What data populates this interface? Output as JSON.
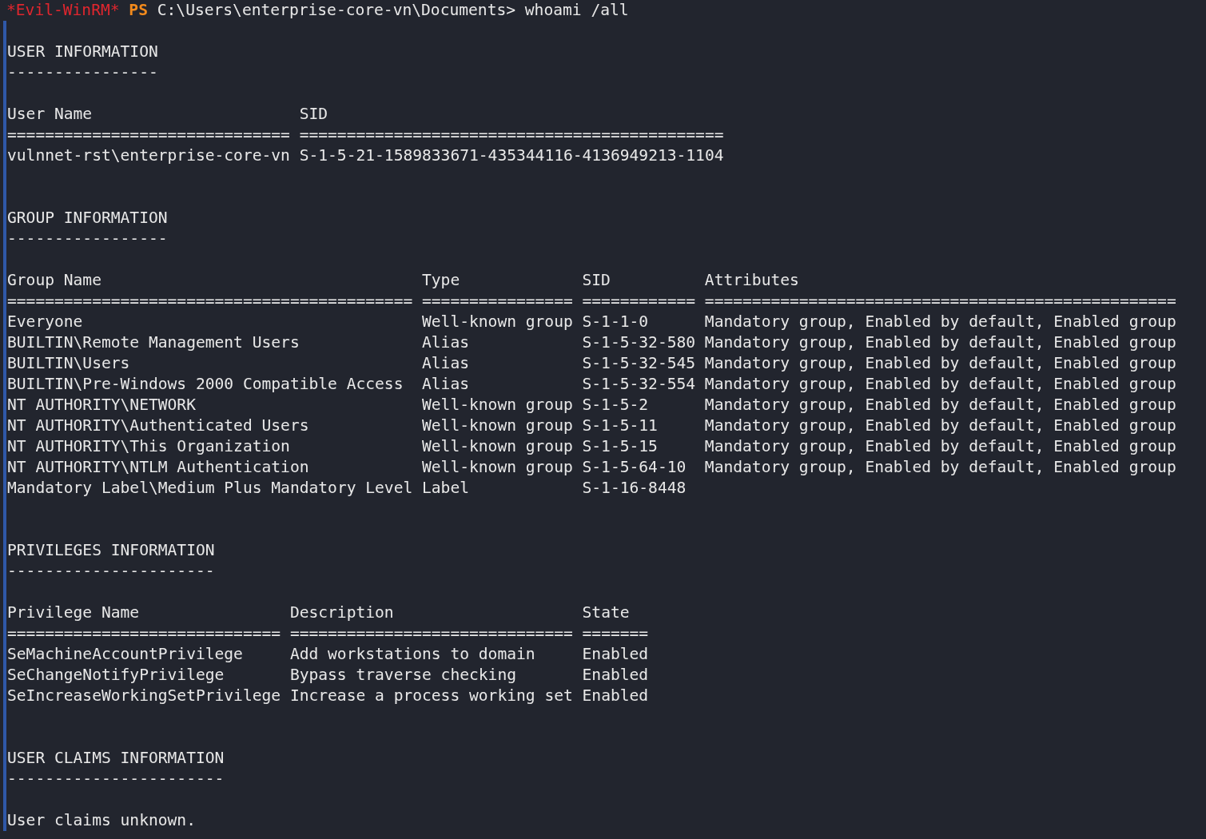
{
  "prompt": {
    "session": "*Evil-WinRM*",
    "shell": "PS",
    "path": "C:\\Users\\enterprise-core-vn\\Documents>",
    "command": "whoami /all"
  },
  "sections": [
    {
      "title": "USER INFORMATION",
      "underline": "----------------",
      "table": {
        "columns": [
          {
            "header": "User Name",
            "rule": "=============================="
          },
          {
            "header": "SID",
            "rule": "============================================="
          }
        ],
        "rows": [
          [
            "vulnnet-rst\\enterprise-core-vn",
            "S-1-5-21-1589833671-435344116-4136949213-1104"
          ]
        ]
      }
    },
    {
      "title": "GROUP INFORMATION",
      "underline": "-----------------",
      "table": {
        "columns": [
          {
            "header": "Group Name",
            "rule": "==========================================="
          },
          {
            "header": "Type",
            "rule": "================"
          },
          {
            "header": "SID",
            "rule": "============"
          },
          {
            "header": "Attributes",
            "rule": "=================================================="
          }
        ],
        "rows": [
          [
            "Everyone",
            "Well-known group",
            "S-1-1-0",
            "Mandatory group, Enabled by default, Enabled group"
          ],
          [
            "BUILTIN\\Remote Management Users",
            "Alias",
            "S-1-5-32-580",
            "Mandatory group, Enabled by default, Enabled group"
          ],
          [
            "BUILTIN\\Users",
            "Alias",
            "S-1-5-32-545",
            "Mandatory group, Enabled by default, Enabled group"
          ],
          [
            "BUILTIN\\Pre-Windows 2000 Compatible Access",
            "Alias",
            "S-1-5-32-554",
            "Mandatory group, Enabled by default, Enabled group"
          ],
          [
            "NT AUTHORITY\\NETWORK",
            "Well-known group",
            "S-1-5-2",
            "Mandatory group, Enabled by default, Enabled group"
          ],
          [
            "NT AUTHORITY\\Authenticated Users",
            "Well-known group",
            "S-1-5-11",
            "Mandatory group, Enabled by default, Enabled group"
          ],
          [
            "NT AUTHORITY\\This Organization",
            "Well-known group",
            "S-1-5-15",
            "Mandatory group, Enabled by default, Enabled group"
          ],
          [
            "NT AUTHORITY\\NTLM Authentication",
            "Well-known group",
            "S-1-5-64-10",
            "Mandatory group, Enabled by default, Enabled group"
          ],
          [
            "Mandatory Label\\Medium Plus Mandatory Level",
            "Label",
            "S-1-16-8448"
          ]
        ]
      }
    },
    {
      "title": "PRIVILEGES INFORMATION",
      "underline": "----------------------",
      "table": {
        "columns": [
          {
            "header": "Privilege Name",
            "rule": "============================="
          },
          {
            "header": "Description",
            "rule": "=============================="
          },
          {
            "header": "State",
            "rule": "======="
          }
        ],
        "rows": [
          [
            "SeMachineAccountPrivilege",
            "Add workstations to domain",
            "Enabled"
          ],
          [
            "SeChangeNotifyPrivilege",
            "Bypass traverse checking",
            "Enabled"
          ],
          [
            "SeIncreaseWorkingSetPrivilege",
            "Increase a process working set",
            "Enabled"
          ]
        ]
      }
    },
    {
      "title": "USER CLAIMS INFORMATION",
      "underline": "-----------------------",
      "text": "User claims unknown."
    }
  ]
}
